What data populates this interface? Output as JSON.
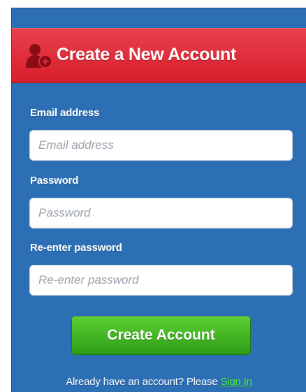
{
  "header": {
    "title": "Create a New Account",
    "icon": "add-user-icon",
    "color": "#e02a37"
  },
  "form": {
    "email": {
      "label": "Email address",
      "placeholder": "Email address",
      "value": ""
    },
    "password": {
      "label": "Password",
      "placeholder": "Password",
      "value": ""
    },
    "confirm": {
      "label": "Re-enter password",
      "placeholder": "Re-enter password",
      "value": ""
    },
    "submit_label": "Create Account",
    "submit_color": "#3fae22"
  },
  "footer": {
    "prompt": "Already have an account? Please ",
    "link_label": "Sign In",
    "link_color": "#4ef33b"
  },
  "panel_color": "#2d6fb5"
}
